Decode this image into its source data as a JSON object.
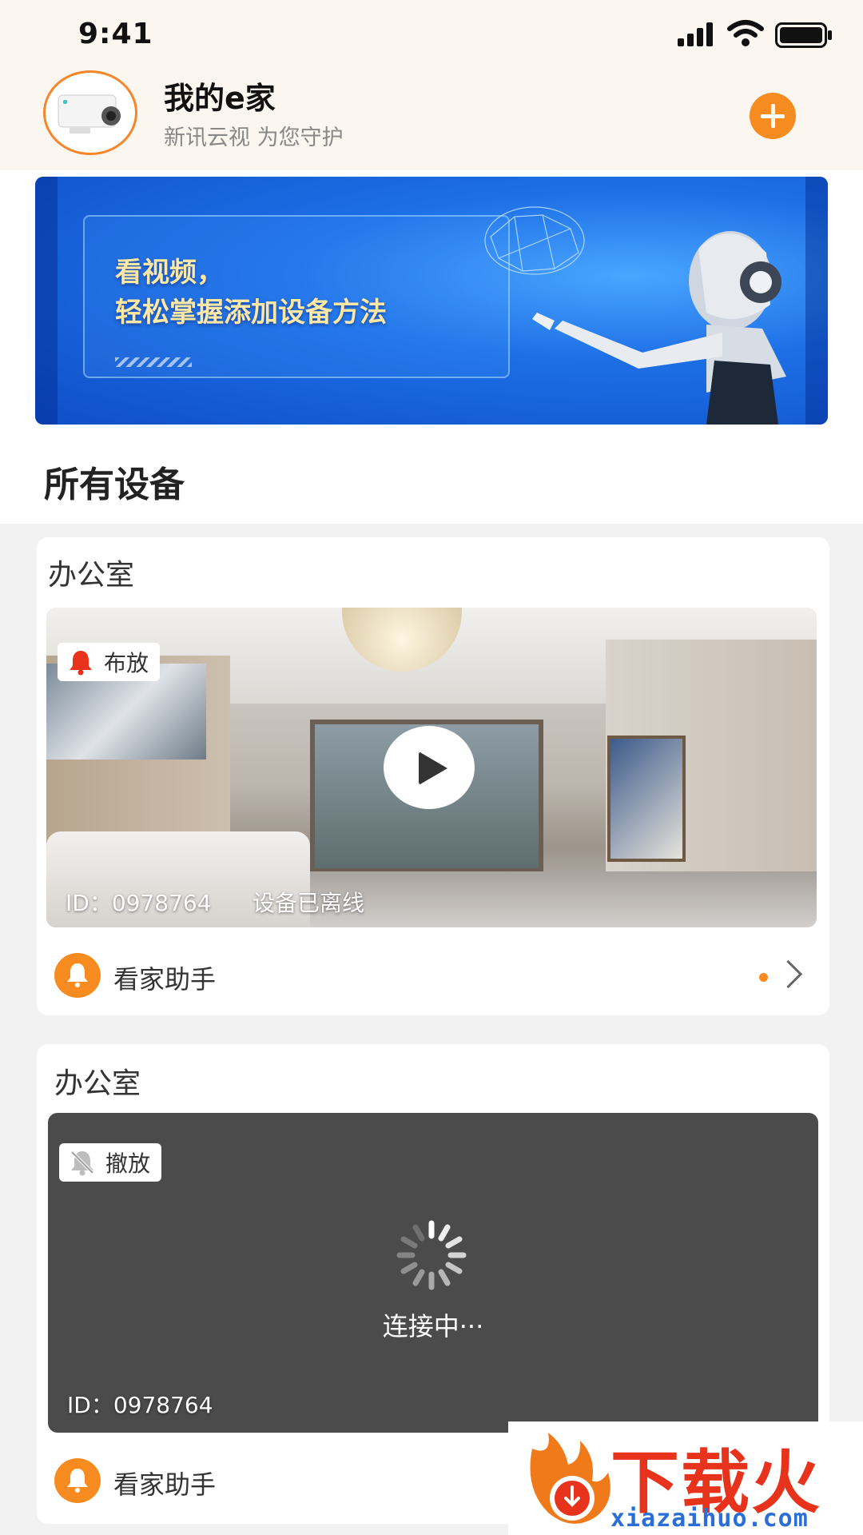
{
  "status_bar": {
    "time": "9:41"
  },
  "header": {
    "title": "我的e家",
    "subtitle": "新讯云视 为您守护"
  },
  "banner": {
    "line1": "看视频，",
    "line2": "轻松掌握添加设备方法"
  },
  "section": {
    "title": "所有设备"
  },
  "devices": [
    {
      "room": "办公室",
      "badge": "布放",
      "id_text": "ID：0978764",
      "status_text": "设备已离线",
      "assistant": "看家助手"
    },
    {
      "room": "办公室",
      "badge": "撤放",
      "connecting": "连接中···",
      "id_text": "ID：0978764",
      "assistant": "看家助手"
    }
  ],
  "watermark": {
    "brand": "下载火",
    "url": "xiazaihuo.com"
  },
  "colors": {
    "accent": "#f68b1f",
    "alarm_red": "#e8331c",
    "header_bg": "#fcf6f0"
  }
}
